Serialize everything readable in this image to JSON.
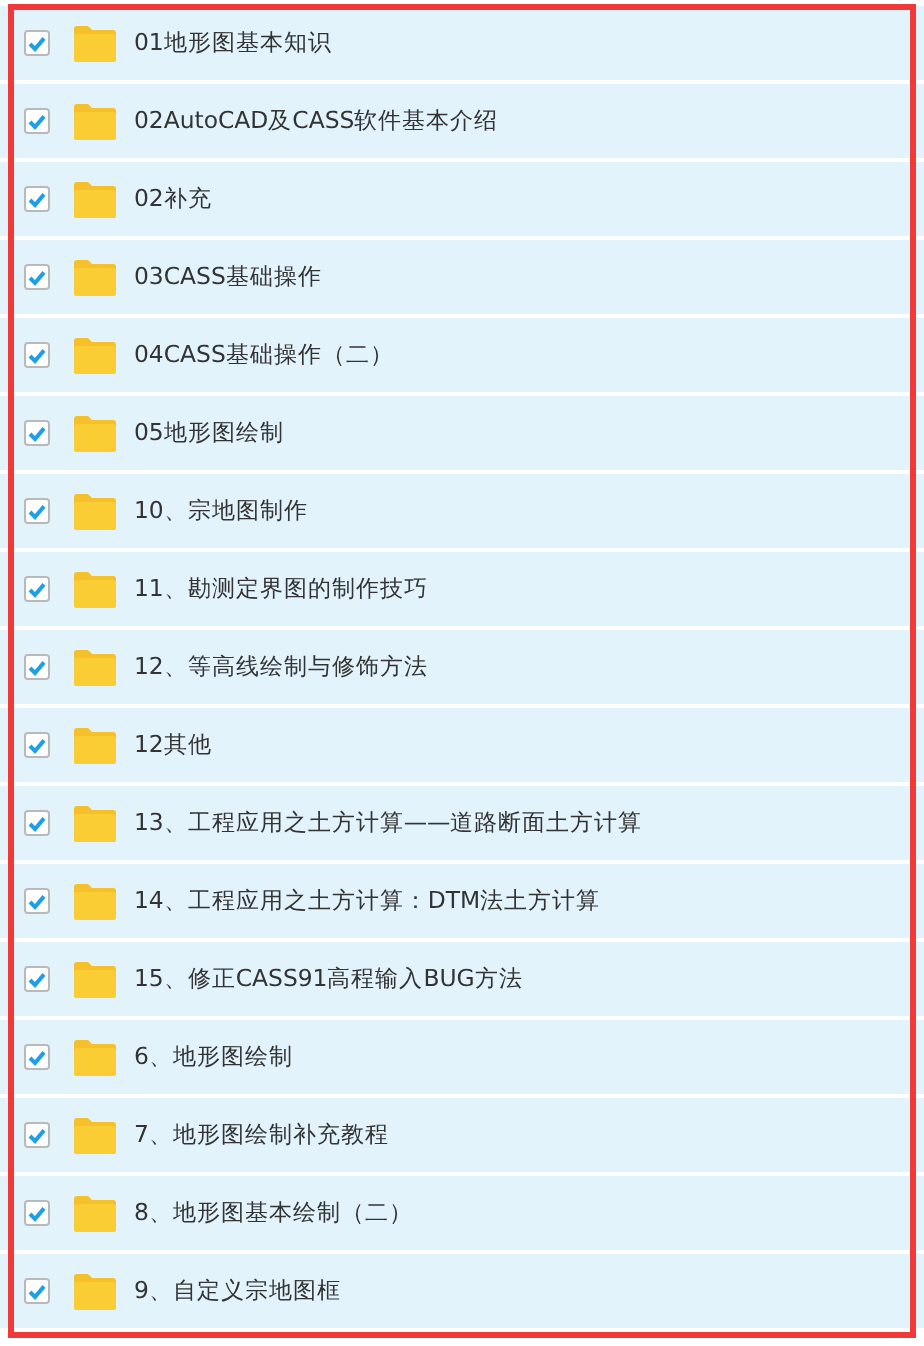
{
  "folders": [
    {
      "name": "01地形图基本知识",
      "checked": true
    },
    {
      "name": "02AutoCAD及CASS软件基本介绍",
      "checked": true
    },
    {
      "name": "02补充",
      "checked": true
    },
    {
      "name": "03CASS基础操作",
      "checked": true
    },
    {
      "name": "04CASS基础操作（二）",
      "checked": true
    },
    {
      "name": "05地形图绘制",
      "checked": true
    },
    {
      "name": "10、宗地图制作",
      "checked": true
    },
    {
      "name": "11、勘测定界图的制作技巧",
      "checked": true
    },
    {
      "name": "12、等高线绘制与修饰方法",
      "checked": true
    },
    {
      "name": "12其他",
      "checked": true
    },
    {
      "name": "13、工程应用之土方计算——道路断面土方计算",
      "checked": true
    },
    {
      "name": "14、工程应用之土方计算：DTM法土方计算",
      "checked": true
    },
    {
      "name": "15、修正CASS91高程输入BUG方法",
      "checked": true
    },
    {
      "name": "6、地形图绘制",
      "checked": true
    },
    {
      "name": "7、地形图绘制补充教程",
      "checked": true
    },
    {
      "name": "8、地形图基本绘制（二）",
      "checked": true
    },
    {
      "name": "9、自定义宗地图框",
      "checked": true
    }
  ]
}
